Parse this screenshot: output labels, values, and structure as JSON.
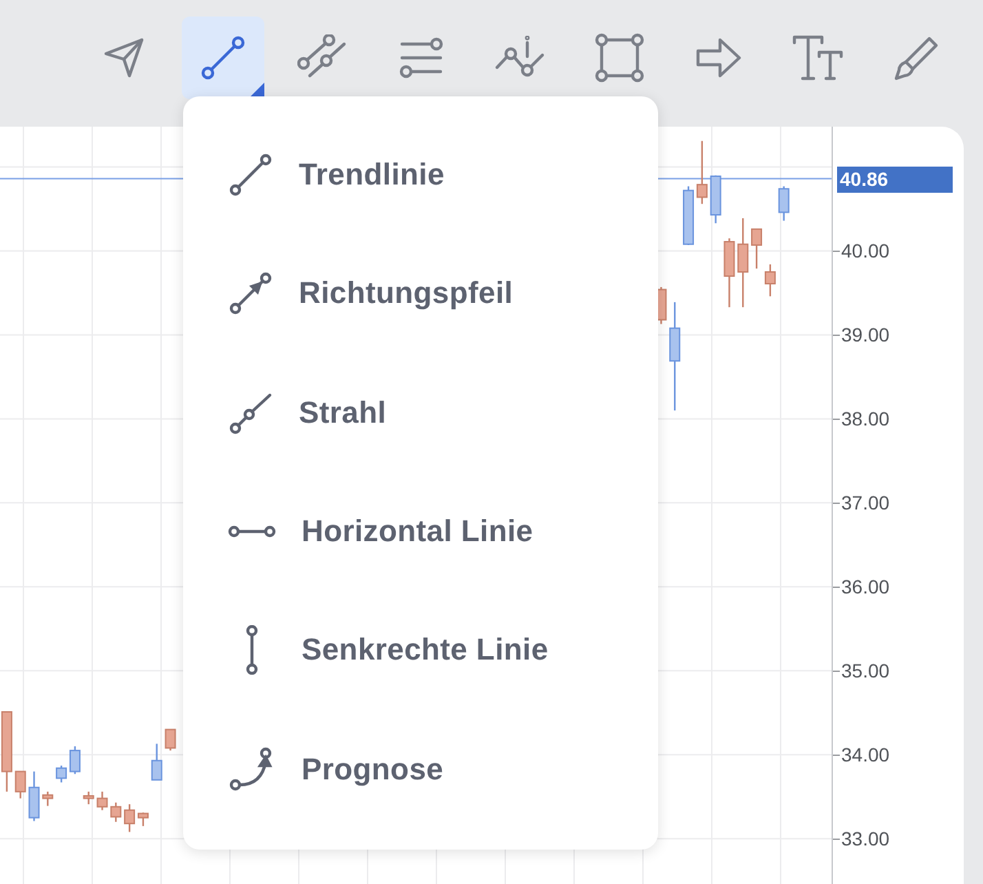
{
  "toolbar": {
    "tools": [
      {
        "kind": "cursor",
        "selected": false
      },
      {
        "kind": "trendline",
        "selected": true
      },
      {
        "kind": "channel",
        "selected": false
      },
      {
        "kind": "levels",
        "selected": false
      },
      {
        "kind": "marker",
        "selected": false
      },
      {
        "kind": "rectangle",
        "selected": false
      },
      {
        "kind": "arrow",
        "selected": false
      },
      {
        "kind": "text",
        "selected": false
      },
      {
        "kind": "brush",
        "selected": false
      }
    ]
  },
  "chart": {
    "chart_data": {
      "type": "candlestick",
      "grid": true,
      "ref_lines": [
        {
          "axis": "y",
          "value": 40.86,
          "label": "40.86"
        }
      ],
      "ylim": [
        32.46,
        41.48
      ],
      "categories": [
        null,
        null,
        null,
        null,
        null,
        null,
        null,
        null,
        null,
        null,
        null,
        null,
        null,
        null,
        null,
        null,
        null,
        null,
        null,
        null,
        null,
        null,
        null,
        null,
        null,
        null,
        null,
        null,
        null,
        null,
        null,
        null,
        null,
        null,
        null,
        null,
        null,
        null,
        null,
        null,
        null,
        null,
        null,
        null,
        null,
        null,
        null,
        null,
        null,
        null,
        null,
        null,
        null,
        null,
        null,
        null,
        null,
        null,
        null,
        null,
        null
      ],
      "yticks": [
        {
          "value": 40,
          "label": "40.00"
        },
        {
          "value": 39,
          "label": "39.00"
        },
        {
          "value": 38,
          "label": "38.00"
        },
        {
          "value": 37,
          "label": "37.00"
        },
        {
          "value": 36,
          "label": "36.00"
        },
        {
          "value": 35,
          "label": "35.00"
        },
        {
          "value": 34,
          "label": "34.00"
        },
        {
          "value": 33,
          "label": "33.00"
        }
      ],
      "ohlc": [
        [
          34.51,
          34.51,
          33.56,
          33.8
        ],
        [
          33.8,
          33.8,
          33.48,
          33.56
        ],
        [
          33.25,
          33.8,
          33.21,
          33.61
        ],
        [
          33.52,
          33.56,
          33.39,
          33.48
        ],
        [
          33.72,
          33.87,
          33.67,
          33.84
        ],
        [
          33.8,
          34.1,
          33.77,
          34.05
        ],
        [
          33.51,
          33.56,
          33.41,
          33.48
        ],
        [
          33.48,
          33.56,
          33.34,
          33.38
        ],
        [
          33.38,
          33.43,
          33.2,
          33.26
        ],
        [
          33.34,
          33.41,
          33.08,
          33.18
        ],
        [
          33.3,
          33.31,
          33.15,
          33.25
        ],
        [
          33.7,
          34.13,
          33.7,
          33.93
        ],
        [
          34.3,
          34.3,
          34.05,
          34.08
        ],
        null,
        null,
        null,
        null,
        null,
        null,
        null,
        null,
        null,
        null,
        null,
        null,
        null,
        null,
        null,
        null,
        null,
        null,
        null,
        null,
        null,
        null,
        null,
        null,
        null,
        null,
        null,
        null,
        null,
        null,
        null,
        null,
        null,
        null,
        null,
        [
          39.54,
          39.57,
          39.13,
          39.18
        ],
        [
          38.69,
          39.39,
          38.1,
          39.08
        ],
        [
          40.08,
          40.77,
          40.07,
          40.72
        ],
        [
          40.79,
          41.31,
          40.56,
          40.64
        ],
        [
          40.43,
          40.9,
          40.33,
          40.89
        ],
        [
          40.11,
          40.15,
          39.33,
          39.7
        ],
        [
          40.08,
          40.39,
          39.33,
          39.75
        ],
        [
          40.26,
          40.26,
          39.79,
          40.07
        ],
        [
          39.75,
          39.84,
          39.46,
          39.61
        ],
        [
          40.46,
          40.77,
          40.36,
          40.74
        ],
        null,
        null,
        null
      ]
    }
  },
  "menu": {
    "items": [
      {
        "kind": "trend",
        "label": "Trendlinie"
      },
      {
        "kind": "arrow",
        "label": "Richtungspfeil"
      },
      {
        "kind": "ray",
        "label": "Strahl"
      },
      {
        "kind": "horizontal",
        "label": "Horizontal Linie"
      },
      {
        "kind": "vertical",
        "label": "Senkrechte Linie"
      },
      {
        "kind": "forecast",
        "label": "Prognose"
      }
    ]
  }
}
